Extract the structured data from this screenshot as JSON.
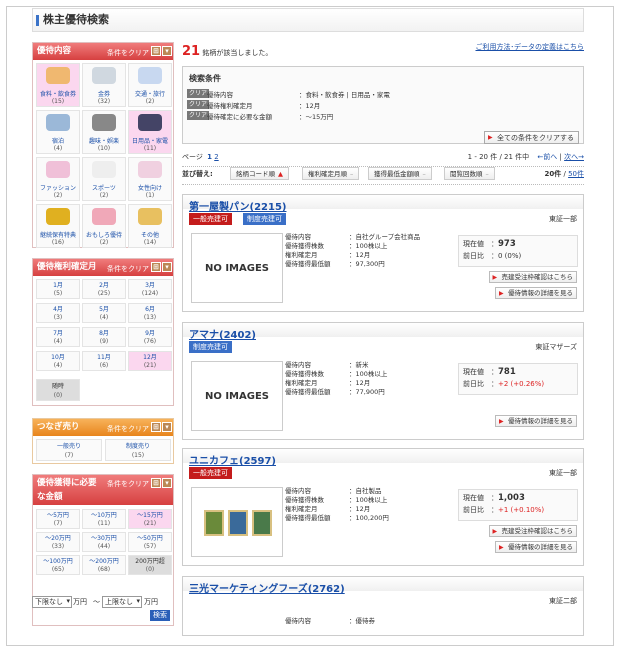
{
  "page": {
    "title": "株主優待検索"
  },
  "sidebar": {
    "benefit": {
      "header": "優待内容",
      "clear": "条件をクリア",
      "items": [
        {
          "label": "食料・飲食券",
          "count": "(15)",
          "selected": true,
          "color": "#f0b870"
        },
        {
          "label": "金券",
          "count": "(32)",
          "selected": false,
          "color": "#d0d8e0"
        },
        {
          "label": "交通・旅行",
          "count": "(2)",
          "selected": false,
          "color": "#c8d8f0"
        },
        {
          "label": "宿泊",
          "count": "(4)",
          "selected": false,
          "color": "#9bb8d8"
        },
        {
          "label": "趣味・娯楽",
          "count": "(10)",
          "selected": false,
          "color": "#888"
        },
        {
          "label": "日用品・家電",
          "count": "(11)",
          "selected": true,
          "color": "#446"
        },
        {
          "label": "ファッション",
          "count": "(2)",
          "selected": false,
          "color": "#f0c0d8"
        },
        {
          "label": "スポーツ",
          "count": "(2)",
          "selected": false,
          "color": "#eee"
        },
        {
          "label": "女性向け",
          "count": "(1)",
          "selected": false,
          "color": "#f0d0e0"
        },
        {
          "label": "継続保有特典",
          "count": "(16)",
          "selected": false,
          "color": "#e0b020"
        },
        {
          "label": "おもしろ優待",
          "count": "(2)",
          "selected": false,
          "color": "#f0a8b8"
        },
        {
          "label": "その他",
          "count": "(14)",
          "selected": false,
          "color": "#e8c060"
        }
      ]
    },
    "month": {
      "header": "優待権利確定月",
      "clear": "条件をクリア",
      "items": [
        {
          "label": "1月",
          "count": "(5)",
          "selected": false
        },
        {
          "label": "2月",
          "count": "(25)",
          "selected": false
        },
        {
          "label": "3月",
          "count": "(124)",
          "selected": false
        },
        {
          "label": "4月",
          "count": "(3)",
          "selected": false
        },
        {
          "label": "5月",
          "count": "(4)",
          "selected": false
        },
        {
          "label": "6月",
          "count": "(13)",
          "selected": false
        },
        {
          "label": "7月",
          "count": "(4)",
          "selected": false
        },
        {
          "label": "8月",
          "count": "(9)",
          "selected": false
        },
        {
          "label": "9月",
          "count": "(76)",
          "selected": false
        },
        {
          "label": "10月",
          "count": "(4)",
          "selected": false
        },
        {
          "label": "11月",
          "count": "(6)",
          "selected": false
        },
        {
          "label": "12月",
          "count": "(21)",
          "selected": true
        }
      ],
      "anytime": {
        "label": "随時",
        "count": "(0)"
      }
    },
    "tsunagi": {
      "header": "つなぎ売り",
      "clear": "条件をクリア",
      "items": [
        {
          "label": "一般売り",
          "count": "(7)"
        },
        {
          "label": "制度売り",
          "count": "(15)"
        }
      ]
    },
    "amount": {
      "header1": "優待獲得に必要",
      "header2": "な金額",
      "clear": "条件をクリア",
      "items": [
        {
          "label": "～5万円",
          "count": "(7)",
          "selected": false
        },
        {
          "label": "～10万円",
          "count": "(11)",
          "selected": false
        },
        {
          "label": "～15万円",
          "count": "(21)",
          "selected": true
        },
        {
          "label": "～20万円",
          "count": "(33)",
          "selected": false
        },
        {
          "label": "～30万円",
          "count": "(44)",
          "selected": false
        },
        {
          "label": "～50万円",
          "count": "(57)",
          "selected": false
        },
        {
          "label": "～100万円",
          "count": "(65)",
          "selected": false
        },
        {
          "label": "～200万円",
          "count": "(68)",
          "selected": false
        },
        {
          "label": "200万円超",
          "count": "(0)",
          "selected": false,
          "dark": true
        }
      ],
      "min_select": "下限なし",
      "max_select": "上限なし",
      "unit": "万円",
      "tilde": "〜",
      "search_btn": "検索"
    }
  },
  "results": {
    "count": "21",
    "count_suffix": "銘柄が該当しました。",
    "help_link": "ご利用方法･データの定義はこちら",
    "conditions": {
      "header": "検索条件",
      "rows": [
        {
          "clear": "クリア",
          "key": "優待内容",
          "value": "：食料・飲食券 | 日用品・家電"
        },
        {
          "clear": "クリア",
          "key": "優待権利確定月",
          "value": "：12月"
        },
        {
          "clear": "クリア",
          "key": "優待確定に必要な金額",
          "value": "：～15万円"
        }
      ],
      "clear_all": "全ての条件をクリアする"
    },
    "pager": {
      "label": "ページ",
      "p1": "1",
      "p2": "2",
      "range": "1 - 20 件 / 21 件中",
      "prev": "←前へ",
      "sep": "|",
      "next": "次へ→"
    },
    "sort": {
      "label": "並び替え:",
      "options": [
        "銘柄コード順",
        "権利確定月順",
        "獲得最低金額順",
        "閲覧回数順"
      ],
      "per_page_a": "20件",
      "per_page_sep": "/",
      "per_page_b": "50件"
    },
    "items": [
      {
        "name": "第一屋製パン(2215)",
        "tags": [
          "一般売建可",
          "制度売建可"
        ],
        "market": "東証一部",
        "image": "NO IMAGES",
        "info": [
          [
            "優待内容",
            "：自社グループ会社商品"
          ],
          [
            "優待獲得株数",
            "：100株以上"
          ],
          [
            "権利確定月",
            "：12月"
          ],
          [
            "優待獲得最低額",
            "：97,300円"
          ]
        ],
        "price_label": "現在値",
        "price": "973",
        "change_label": "前日比",
        "change": "0 (0%)",
        "btn1": "売建受注枠確認はこちら",
        "btn2": "優待情報の詳細を見る"
      },
      {
        "name": "アマナ(2402)",
        "tags": [
          "制度売建可"
        ],
        "market": "東証マザーズ",
        "image": "NO IMAGES",
        "info": [
          [
            "優待内容",
            "：新米"
          ],
          [
            "優待獲得株数",
            "：100株以上"
          ],
          [
            "権利確定月",
            "：12月"
          ],
          [
            "優待獲得最低額",
            "：77,900円"
          ]
        ],
        "price_label": "現在値",
        "price": "781",
        "change_label": "前日比",
        "change": "+2 (+0.26%)",
        "btn2": "優待情報の詳細を見る"
      },
      {
        "name": "ユニカフェ(2597)",
        "tags": [
          "一般売建可"
        ],
        "market": "東証一部",
        "image": "",
        "info": [
          [
            "優待内容",
            "：自社製品"
          ],
          [
            "優待獲得株数",
            "：100株以上"
          ],
          [
            "権利確定月",
            "：12月"
          ],
          [
            "優待獲得最低額",
            "：100,200円"
          ]
        ],
        "price_label": "現在値",
        "price": "1,003",
        "change_label": "前日比",
        "change": "+1 (+0.10%)",
        "btn1": "売建受注枠確認はこちら",
        "btn2": "優待情報の詳細を見る"
      },
      {
        "name": "三光マーケティングフーズ(2762)",
        "market": "東証二部",
        "info": [
          [
            "優待内容",
            "：優待券"
          ]
        ]
      }
    ]
  },
  "colors": {
    "accent_blue": "#1a4fa8",
    "header_red": "#d64040",
    "header_orange": "#e8851d",
    "selected_pink": "#fbd7ef",
    "price_up": "#dd2222"
  }
}
